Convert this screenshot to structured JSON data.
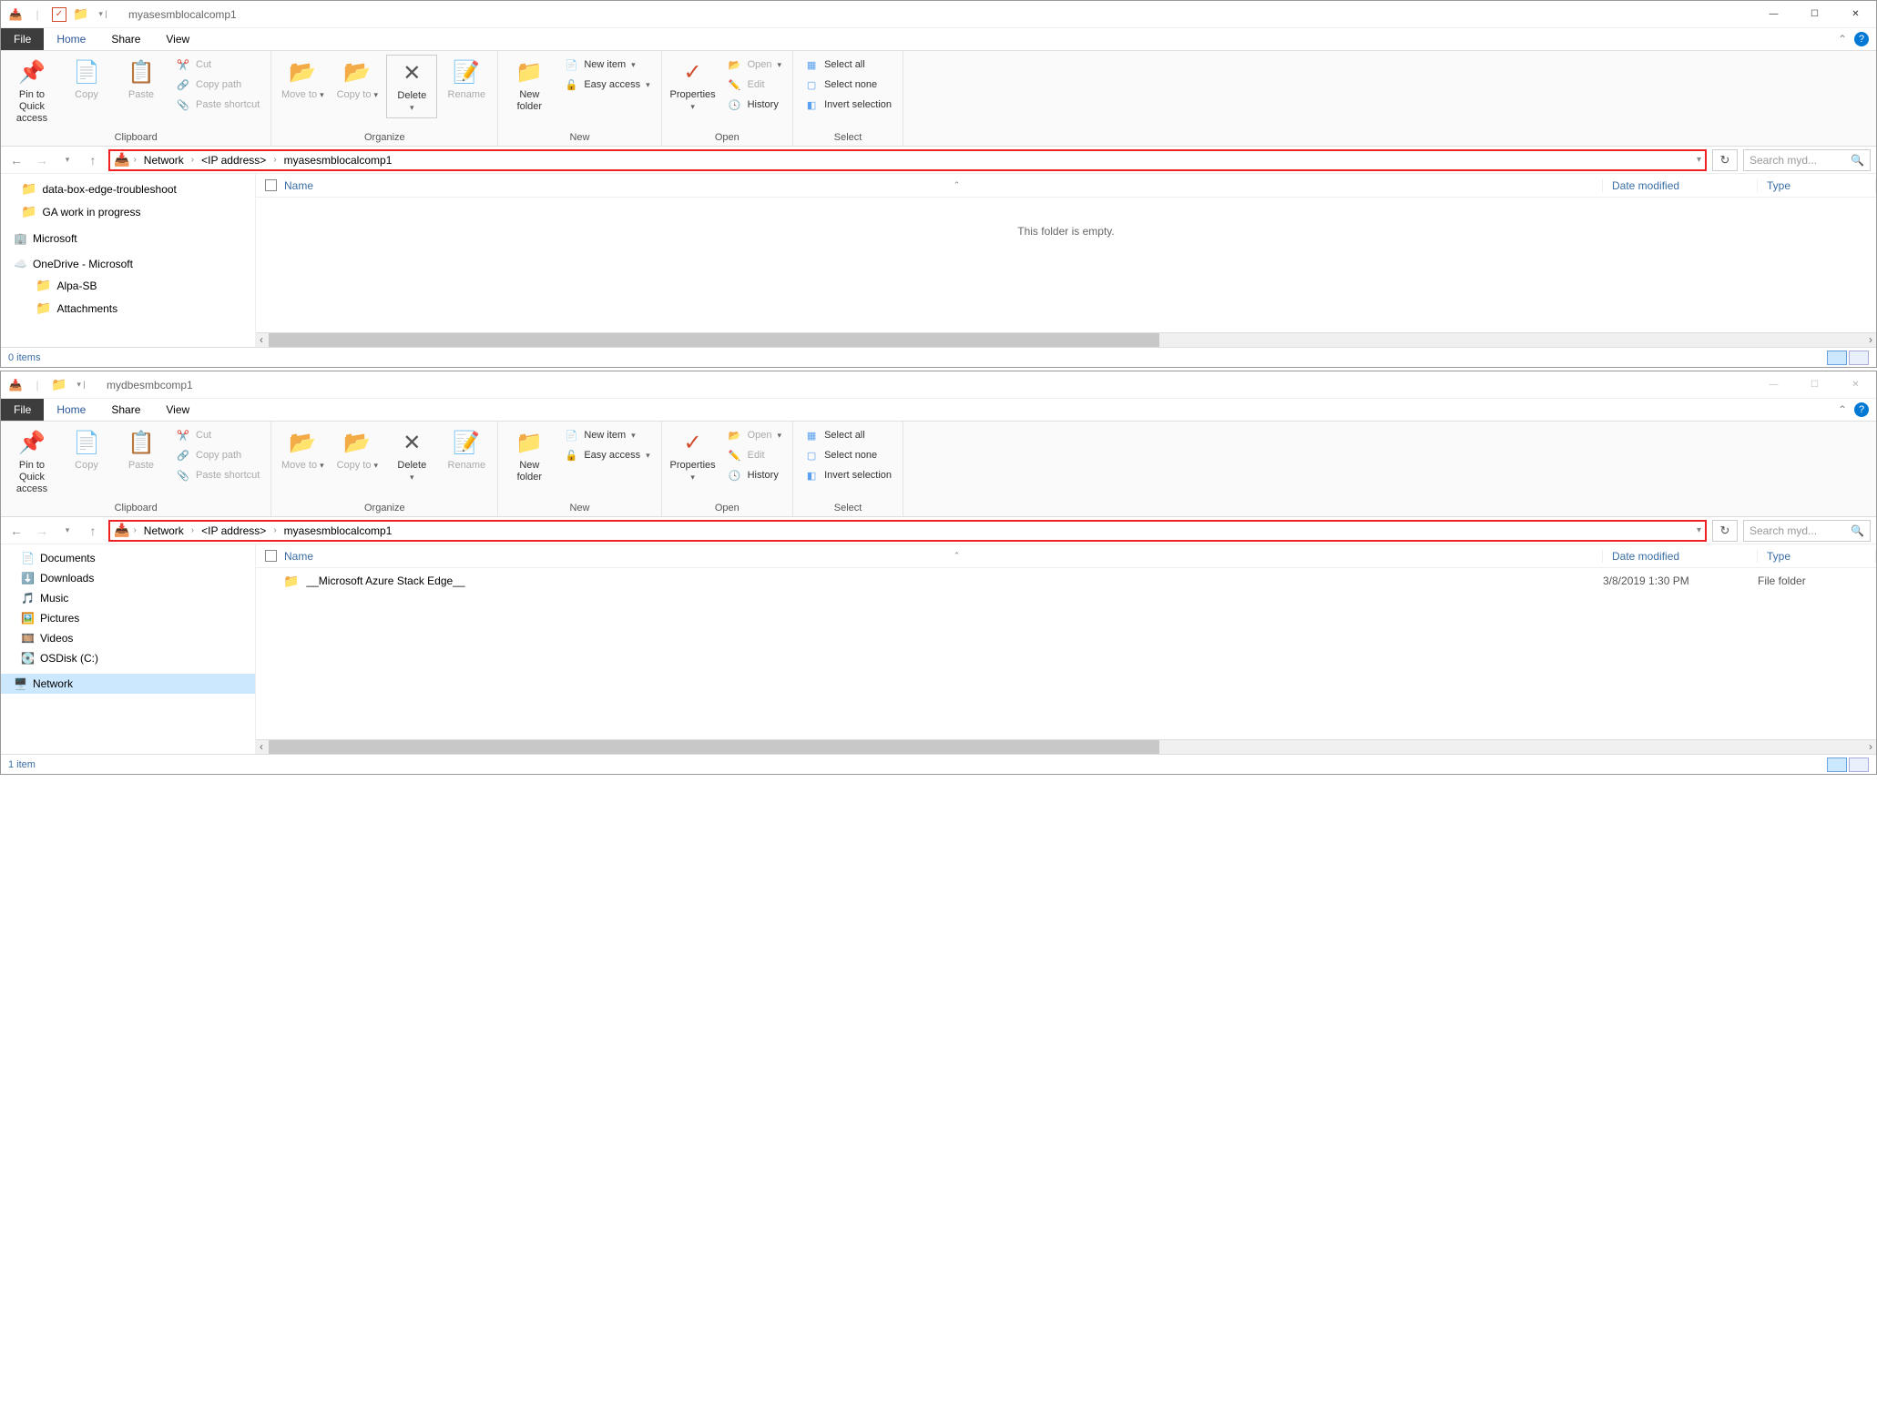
{
  "window1": {
    "title": "myasesmblocalcomp1",
    "tabs": {
      "file": "File",
      "home": "Home",
      "share": "Share",
      "view": "View"
    },
    "ribbon": {
      "clipboard": {
        "pin": "Pin to Quick access",
        "copy": "Copy",
        "paste": "Paste",
        "cut": "Cut",
        "copypath": "Copy path",
        "pasteshortcut": "Paste shortcut",
        "label": "Clipboard"
      },
      "organize": {
        "moveto": "Move to",
        "copyto": "Copy to",
        "delete": "Delete",
        "rename": "Rename",
        "label": "Organize"
      },
      "new": {
        "newfolder": "New folder",
        "newitem": "New item",
        "easyaccess": "Easy access",
        "label": "New"
      },
      "open": {
        "properties": "Properties",
        "open": "Open",
        "edit": "Edit",
        "history": "History",
        "label": "Open"
      },
      "select": {
        "selectall": "Select all",
        "selectnone": "Select none",
        "invert": "Invert selection",
        "label": "Select"
      }
    },
    "breadcrumb": {
      "p1": "Network",
      "p2": "<IP address>",
      "p3": "myasesmblocalcomp1"
    },
    "search_placeholder": "Search myd...",
    "columns": {
      "name": "Name",
      "date": "Date modified",
      "type": "Type"
    },
    "nav": {
      "i0": "data-box-edge-troubleshoot",
      "i1": "GA work in progress",
      "i2": "Microsoft",
      "i3": "OneDrive - Microsoft",
      "i4": "Alpa-SB",
      "i5": "Attachments"
    },
    "empty": "This folder is empty.",
    "status": "0 items"
  },
  "window2": {
    "title": "mydbesmbcomp1",
    "tabs": {
      "file": "File",
      "home": "Home",
      "share": "Share",
      "view": "View"
    },
    "ribbon": {
      "clipboard": {
        "pin": "Pin to Quick access",
        "copy": "Copy",
        "paste": "Paste",
        "cut": "Cut",
        "copypath": "Copy path",
        "pasteshortcut": "Paste shortcut",
        "label": "Clipboard"
      },
      "organize": {
        "moveto": "Move to",
        "copyto": "Copy to",
        "delete": "Delete",
        "rename": "Rename",
        "label": "Organize"
      },
      "new": {
        "newfolder": "New folder",
        "newitem": "New item",
        "easyaccess": "Easy access",
        "label": "New"
      },
      "open": {
        "properties": "Properties",
        "open": "Open",
        "edit": "Edit",
        "history": "History",
        "label": "Open"
      },
      "select": {
        "selectall": "Select all",
        "selectnone": "Select none",
        "invert": "Invert selection",
        "label": "Select"
      }
    },
    "breadcrumb": {
      "p1": "Network",
      "p2": "<IP address>",
      "p3": "myasesmblocalcomp1"
    },
    "search_placeholder": "Search myd...",
    "columns": {
      "name": "Name",
      "date": "Date modified",
      "type": "Type"
    },
    "nav": {
      "i0": "Documents",
      "i1": "Downloads",
      "i2": "Music",
      "i3": "Pictures",
      "i4": "Videos",
      "i5": "OSDisk (C:)",
      "i6": "Network"
    },
    "files": {
      "f0": {
        "name": "__Microsoft Azure Stack Edge__",
        "date": "3/8/2019 1:30 PM",
        "type": "File folder"
      }
    },
    "status": "1 item"
  }
}
